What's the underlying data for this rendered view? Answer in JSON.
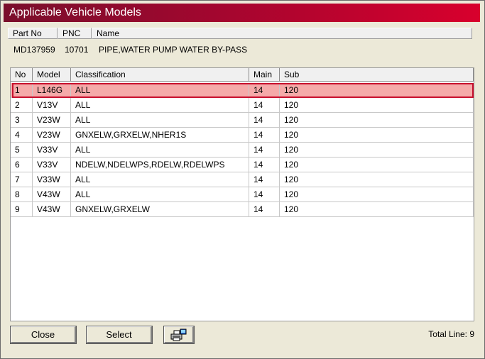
{
  "window": {
    "title": "Applicable Vehicle Models"
  },
  "part": {
    "headers": {
      "part_no": "Part No",
      "pnc": "PNC",
      "name": "Name"
    },
    "values": {
      "part_no": "MD137959",
      "pnc": "10701",
      "name": "PIPE,WATER PUMP WATER BY-PASS"
    }
  },
  "table": {
    "columns": [
      "No",
      "Model",
      "Classification",
      "Main",
      "Sub"
    ],
    "rows": [
      [
        "1",
        "L146G",
        "ALL",
        "14",
        "120"
      ],
      [
        "2",
        "V13V",
        "ALL",
        "14",
        "120"
      ],
      [
        "3",
        "V23W",
        "ALL",
        "14",
        "120"
      ],
      [
        "4",
        "V23W",
        "GNXELW,GRXELW,NHER1S",
        "14",
        "120"
      ],
      [
        "5",
        "V33V",
        "ALL",
        "14",
        "120"
      ],
      [
        "6",
        "V33V",
        "NDELW,NDELWPS,RDELW,RDELWPS",
        "14",
        "120"
      ],
      [
        "7",
        "V33W",
        "ALL",
        "14",
        "120"
      ],
      [
        "8",
        "V43W",
        "ALL",
        "14",
        "120"
      ],
      [
        "9",
        "V43W",
        "GNXELW,GRXELW",
        "14",
        "120"
      ]
    ],
    "selected_row": 1
  },
  "footer": {
    "close_label": "Close",
    "select_label": "Select",
    "print_icon": "printer-icon",
    "total_line": "Total Line: 9"
  },
  "colors": {
    "title_start": "#7a0f2c",
    "title_end": "#d8002d",
    "selected_fill": "#f5aaa9",
    "selected_border": "#c8102e"
  }
}
